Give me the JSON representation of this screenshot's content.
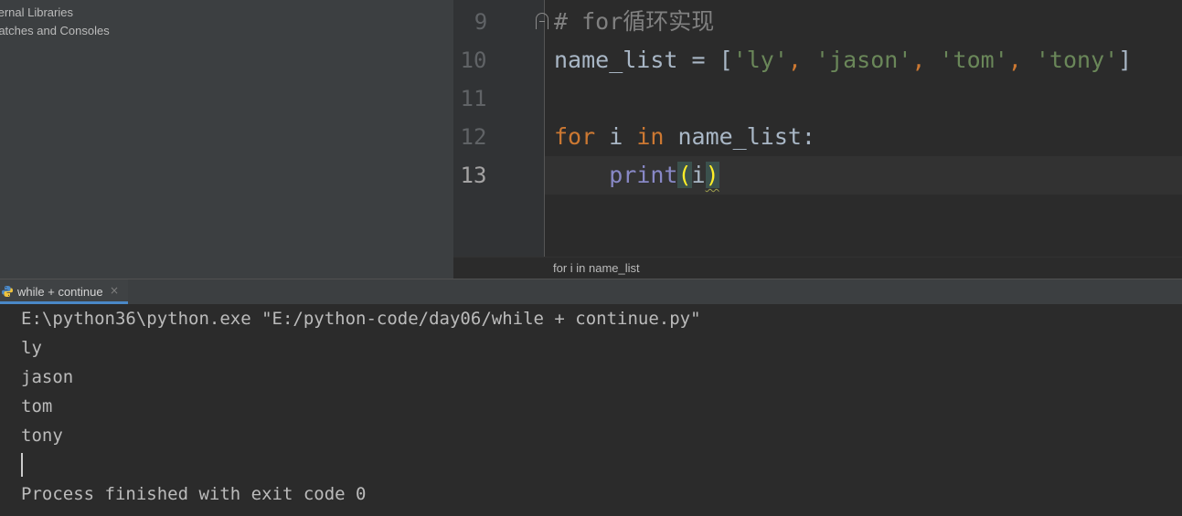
{
  "project_tree": {
    "items": [
      {
        "label": "ternal Libraries"
      },
      {
        "label": "ratches and Consoles"
      }
    ]
  },
  "editor": {
    "line_numbers": [
      "9",
      "10",
      "11",
      "12",
      "13"
    ],
    "code": {
      "line9_comment": "# for循环实现",
      "line10": {
        "name": "name_list",
        "assign": " = [",
        "strings": [
          "'ly'",
          "'jason'",
          "'tom'",
          "'tony'"
        ],
        "sep": ", ",
        "close": "]"
      },
      "line12": {
        "kw_for": "for",
        "var": " i ",
        "kw_in": "in",
        "iter": " name_list:"
      },
      "line13": {
        "indent": "    ",
        "func": "print",
        "open": "(",
        "arg": "i",
        "close": ")"
      }
    },
    "breadcrumb": "for i in name_list"
  },
  "run_panel": {
    "tab_label": "while + continue",
    "tab_close": "×",
    "console_lines": [
      "E:\\python36\\python.exe \"E:/python-code/day06/while + continue.py\"",
      "ly",
      "jason",
      "tom",
      "tony",
      "Process finished with exit code 0"
    ]
  },
  "icons": {
    "python_file_icon": "python-icon",
    "tab_close_icon": "close-icon",
    "fold_icon": "fold-marker-icon"
  },
  "colors": {
    "keyword": "#cc7832",
    "string": "#6a8759",
    "comment": "#808080",
    "builtin": "#8888c6",
    "tab_accent": "#4a88c7"
  }
}
